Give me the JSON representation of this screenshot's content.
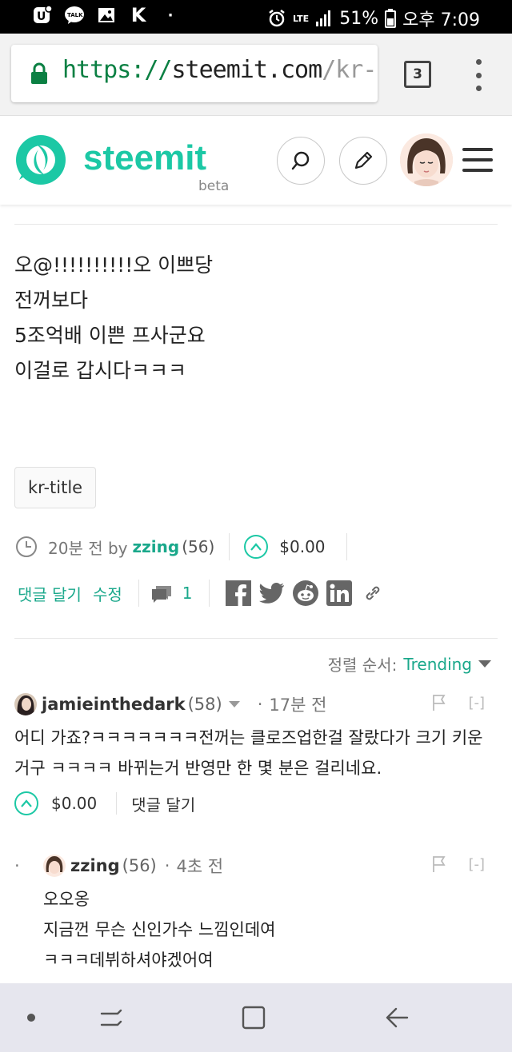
{
  "status_bar": {
    "notification_icons": [
      "u-plus-icon",
      "kakaotalk-icon",
      "gallery-icon",
      "k-app-icon"
    ],
    "talk_label": "TALK",
    "k_label": "K",
    "dot": "·",
    "network": "LTE",
    "battery": "51%",
    "time": "오후 7:09"
  },
  "browser": {
    "url_scheme": "https://",
    "url_host": "steemit.com",
    "url_path": "/kr-title",
    "tab_count": "3"
  },
  "header": {
    "logo_text": "steemit",
    "beta_label": "beta",
    "accent_color": "#1cc8a5"
  },
  "post": {
    "body_lines": [
      "오@!!!!!!!!!!오 이쁘당",
      "전꺼보다",
      "5조억배 이쁜 프사군요",
      "이걸로 갑시다ㅋㅋㅋ"
    ],
    "tag": "kr-title",
    "time_ago": "20분 전 by",
    "author": "zzing",
    "author_rep": "(56)",
    "payout": "$0.00",
    "reply_label": "댓글 달기",
    "edit_label": "수정",
    "comment_count": "1"
  },
  "sort": {
    "label": "정렬 순서:",
    "value": "Trending"
  },
  "comments": [
    {
      "author": "jamieinthedark",
      "rep": "(58)",
      "time": "17분 전",
      "text": "어디 가죠?ㅋㅋㅋㅋㅋㅋㅋ전꺼는 클로즈업한걸 잘랐다가 크기 키운거구 ㅋㅋㅋㅋ 바뀌는거 반영만 한 몇 분은 걸리네요.",
      "payout": "$0.00",
      "reply_label": "댓글 달기",
      "collapse": "[-]"
    },
    {
      "author": "zzing",
      "rep": "(56)",
      "time": "4초 전",
      "lines": [
        "오오옹",
        "지금껀 무슨 신인가수 느낌인데여",
        "ㅋㅋㅋ데뷔하셔야겠어여"
      ],
      "collapse": "[-]"
    }
  ],
  "separator_dot": "·"
}
